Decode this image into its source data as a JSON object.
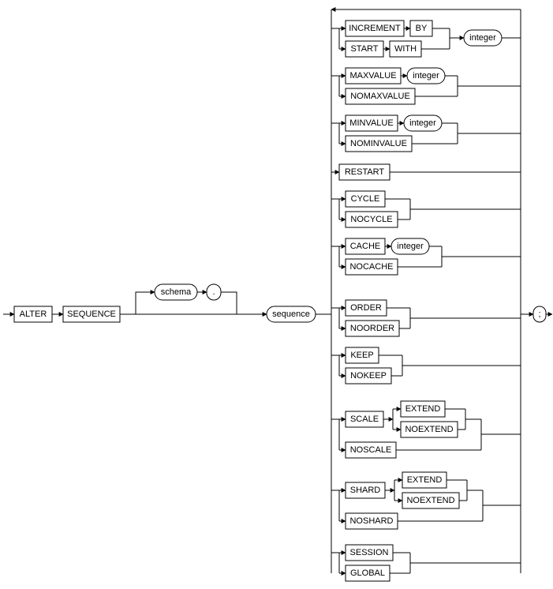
{
  "keywords": {
    "alter": "ALTER",
    "sequence_kw": "SEQUENCE",
    "increment": "INCREMENT",
    "by": "BY",
    "start": "START",
    "with": "WITH",
    "maxvalue": "MAXVALUE",
    "nomaxvalue": "NOMAXVALUE",
    "minvalue": "MINVALUE",
    "nominvalue": "NOMINVALUE",
    "restart": "RESTART",
    "cycle": "CYCLE",
    "nocycle": "NOCYCLE",
    "cache": "CACHE",
    "nocache": "NOCACHE",
    "order": "ORDER",
    "noorder": "NOORDER",
    "keep": "KEEP",
    "nokeep": "NOKEEP",
    "scale": "SCALE",
    "noscale": "NOSCALE",
    "extend1": "EXTEND",
    "noextend1": "NOEXTEND",
    "shard": "SHARD",
    "noshard": "NOSHARD",
    "extend2": "EXTEND",
    "noextend2": "NOEXTEND",
    "session": "SESSION",
    "global": "GLOBAL"
  },
  "terminals": {
    "schema": "schema",
    "dot": ".",
    "sequence": "sequence",
    "integer1": "integer",
    "integer2": "integer",
    "integer3": "integer",
    "integer4": "integer",
    "semicolon": ";"
  }
}
